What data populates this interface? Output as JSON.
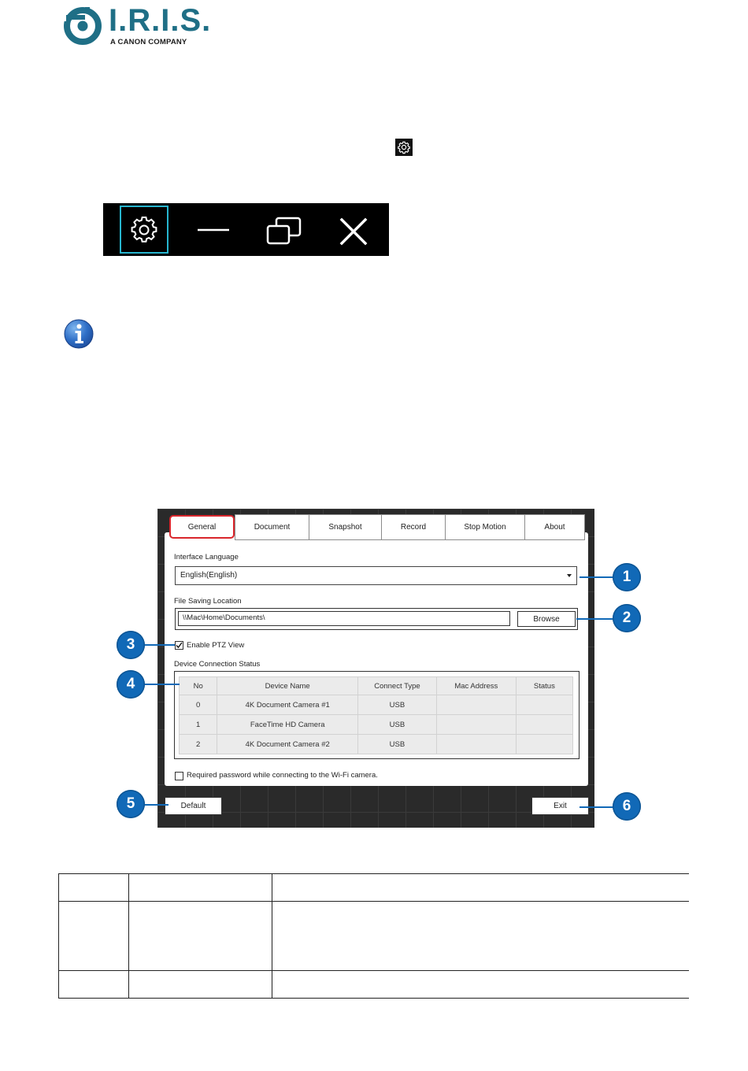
{
  "logo": {
    "wordmark": "I.R.I.S.",
    "tagline": "A CANON COMPANY",
    "brand_color": "#1f6f86"
  },
  "inline_icon": "gear-icon",
  "toolbar": {
    "buttons": [
      {
        "icon": "gear-icon",
        "highlighted": true
      },
      {
        "icon": "minimize-icon"
      },
      {
        "icon": "restore-window-icon"
      },
      {
        "icon": "close-icon"
      }
    ],
    "highlight_color": "#27b6cf"
  },
  "info_icon": "info-icon",
  "dialog": {
    "tabs": [
      "General",
      "Document",
      "Snapshot",
      "Record",
      "Stop Motion",
      "About"
    ],
    "active_tab": "General",
    "interface_language_label": "Interface Language",
    "interface_language_value": "English(English)",
    "file_saving_location_label": "File Saving Location",
    "file_saving_location_value": "\\\\Mac\\Home\\Documents\\",
    "browse_label": "Browse",
    "enable_ptz_label": "Enable PTZ View",
    "enable_ptz_checked": true,
    "device_status_label": "Device Connection Status",
    "device_table": {
      "columns": [
        "No",
        "Device Name",
        "Connect Type",
        "Mac Address",
        "Status"
      ],
      "rows": [
        [
          "0",
          "4K Document Camera #1",
          "USB",
          "",
          ""
        ],
        [
          "1",
          "FaceTime HD Camera",
          "USB",
          "",
          ""
        ],
        [
          "2",
          "4K Document Camera #2",
          "USB",
          "",
          ""
        ]
      ]
    },
    "wifi_password_label": "Required password while connecting to the Wi-Fi camera.",
    "wifi_password_checked": false,
    "default_label": "Default",
    "exit_label": "Exit"
  },
  "callouts": [
    "1",
    "2",
    "3",
    "4",
    "5",
    "6"
  ],
  "colors": {
    "callout": "#1169b7",
    "active_tab_border": "#d9262c"
  }
}
